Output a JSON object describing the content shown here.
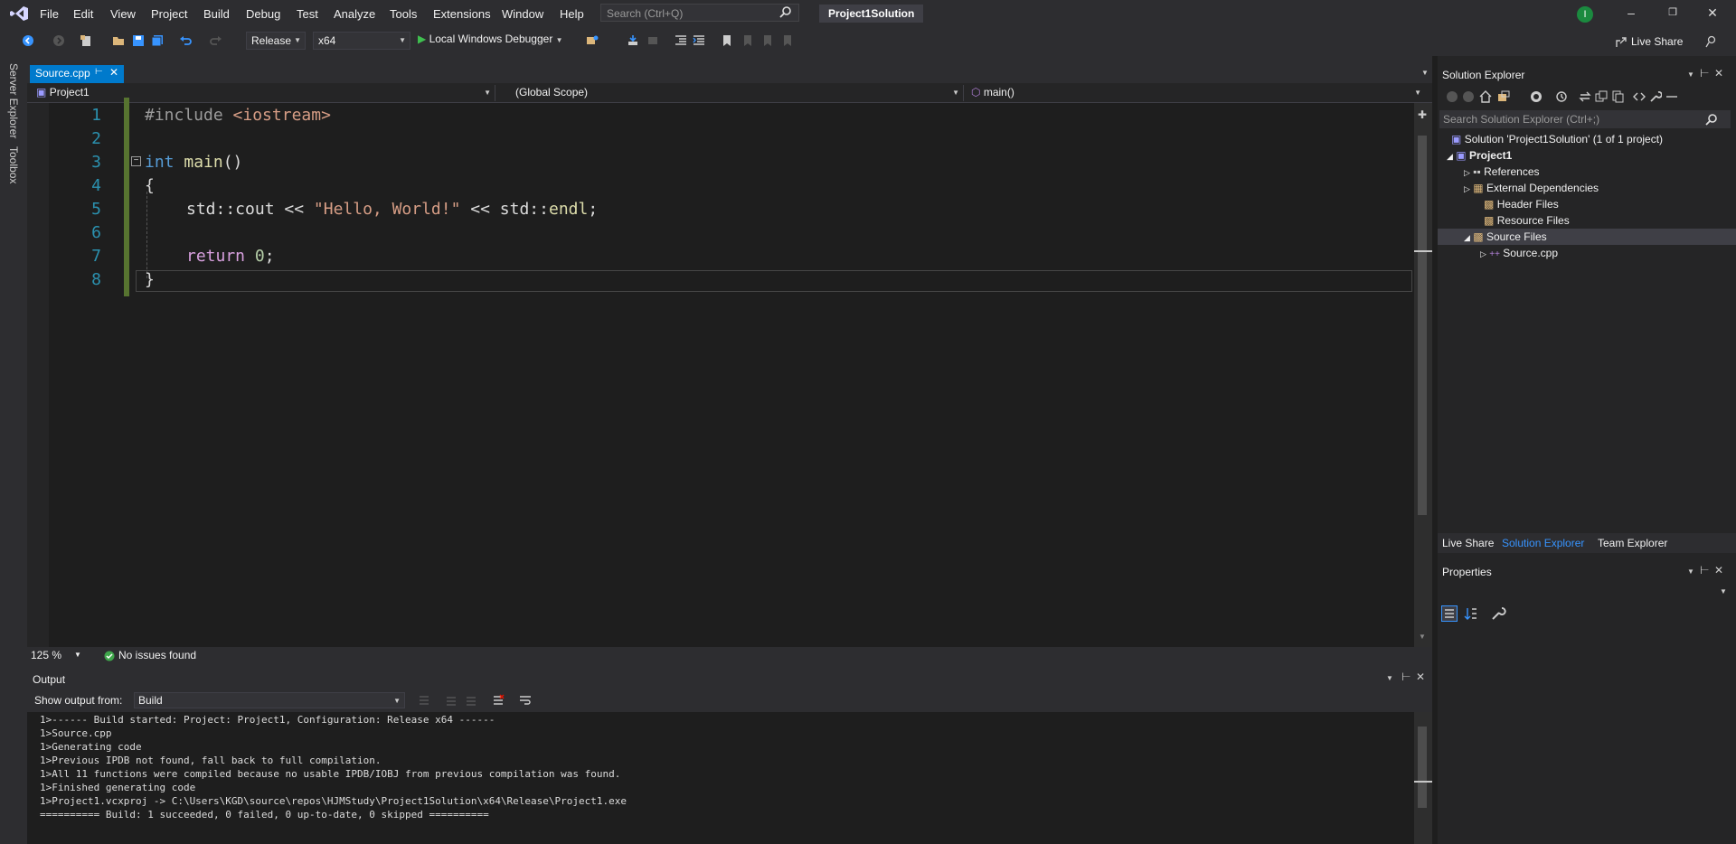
{
  "titlebar": {
    "menu": [
      "File",
      "Edit",
      "View",
      "Project",
      "Build",
      "Debug",
      "Test",
      "Analyze",
      "Tools",
      "Extensions",
      "Window",
      "Help"
    ],
    "search_placeholder": "Search (Ctrl+Q)",
    "solution_title": "Project1Solution",
    "avatar_initial": "I"
  },
  "toolbar": {
    "configuration": "Release",
    "platform": "x64",
    "debugger": "Local Windows Debugger",
    "live_share": "Live Share"
  },
  "sidebar": {
    "tabs": [
      "Server Explorer",
      "Toolbox"
    ]
  },
  "editor": {
    "tab": "Source.cpp",
    "nav_project": "Project1",
    "nav_scope": "(Global Scope)",
    "nav_member": "main()",
    "lines": [
      "1",
      "2",
      "3",
      "4",
      "5",
      "6",
      "7",
      "8"
    ],
    "code": {
      "l1_pre": "#include ",
      "l1_inc": "<iostream>",
      "l3_kw": "int",
      "l3_fn": "main",
      "l3_rest": "()",
      "l4": "{",
      "l5_a": "std::cout << ",
      "l5_str": "\"Hello, World!\"",
      "l5_b": " << std::",
      "l5_fn": "endl",
      "l5_c": ";",
      "l7_kw": "return",
      "l7_num": "0",
      "l7_end": ";",
      "l8": "}"
    },
    "zoom": "125 %",
    "status": "No issues found"
  },
  "output": {
    "title": "Output",
    "show_from_label": "Show output from:",
    "source": "Build",
    "lines": [
      "1>------ Build started: Project: Project1, Configuration: Release x64 ------",
      "1>Source.cpp",
      "1>Generating code",
      "1>Previous IPDB not found, fall back to full compilation.",
      "1>All 11 functions were compiled because no usable IPDB/IOBJ from previous compilation was found.",
      "1>Finished generating code",
      "1>Project1.vcxproj -> C:\\Users\\KGD\\source\\repos\\HJMStudy\\Project1Solution\\x64\\Release\\Project1.exe",
      "========== Build: 1 succeeded, 0 failed, 0 up-to-date, 0 skipped =========="
    ]
  },
  "solution_explorer": {
    "title": "Solution Explorer",
    "search_placeholder": "Search Solution Explorer (Ctrl+;)",
    "solution": "Solution 'Project1Solution' (1 of 1 project)",
    "project": "Project1",
    "items": [
      "References",
      "External Dependencies",
      "Header Files",
      "Resource Files",
      "Source Files",
      "Source.cpp"
    ],
    "tabs": [
      "Live Share",
      "Solution Explorer",
      "Team Explorer"
    ]
  },
  "properties": {
    "title": "Properties"
  },
  "colors": {
    "accent": "#007acc",
    "selected_tab_text": "#3794ff"
  }
}
